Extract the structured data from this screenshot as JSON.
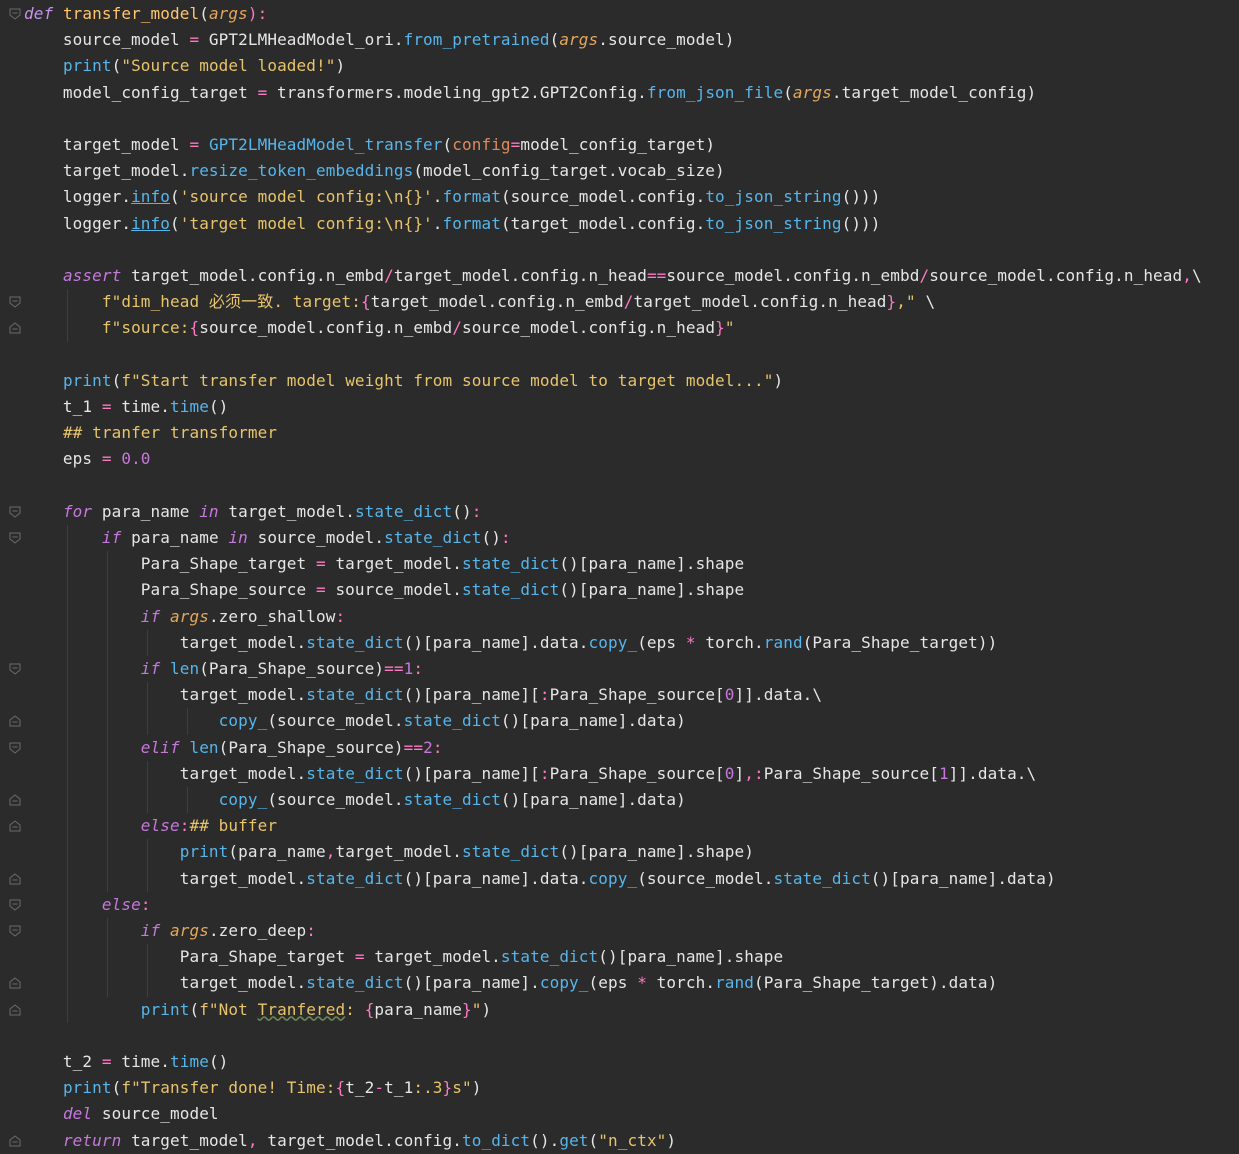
{
  "editor": {
    "language": "python",
    "theme_colors": {
      "background": "#2b2b2b",
      "keyword": "#c678dd",
      "function_name": "#ffc66d",
      "method": "#56b6ec",
      "string": "#e8c46a",
      "number": "#c678dd",
      "operator": "#ff79c6",
      "argument": "#e5a75b"
    },
    "lines": [
      [
        [
          "def",
          "def"
        ],
        [
          " ",
          "d"
        ],
        [
          "transfer_model",
          "fn"
        ],
        [
          "(",
          "p"
        ],
        [
          "args",
          "arg"
        ],
        [
          "):",
          "op"
        ]
      ],
      [
        [
          "    source_model ",
          "d"
        ],
        [
          "=",
          "op"
        ],
        [
          " GPT2LMHeadModel_ori.",
          "d"
        ],
        [
          "from_pretrained",
          "m"
        ],
        [
          "(",
          "p"
        ],
        [
          "args",
          "arg"
        ],
        [
          ".source_model)",
          "d"
        ]
      ],
      [
        [
          "    ",
          "d"
        ],
        [
          "print",
          "b"
        ],
        [
          "(",
          "p"
        ],
        [
          "\"Source model loaded!\"",
          "s"
        ],
        [
          ")",
          "p"
        ]
      ],
      [
        [
          "    model_config_target ",
          "d"
        ],
        [
          "=",
          "op"
        ],
        [
          " transformers.modeling_gpt2.GPT2Config.",
          "d"
        ],
        [
          "from_json_file",
          "m"
        ],
        [
          "(",
          "p"
        ],
        [
          "args",
          "arg"
        ],
        [
          ".target_model_config)",
          "d"
        ]
      ],
      [],
      [
        [
          "    target_model ",
          "d"
        ],
        [
          "=",
          "op"
        ],
        [
          " ",
          "d"
        ],
        [
          "GPT2LMHeadModel_transfer",
          "m"
        ],
        [
          "(",
          "p"
        ],
        [
          "config",
          "param"
        ],
        [
          "=",
          "op"
        ],
        [
          "model_config_target)",
          "d"
        ]
      ],
      [
        [
          "    target_model.",
          "d"
        ],
        [
          "resize_token_embeddings",
          "m"
        ],
        [
          "(model_config_target.vocab_size)",
          "d"
        ]
      ],
      [
        [
          "    logger.",
          "d"
        ],
        [
          "info",
          "mu"
        ],
        [
          "(",
          "p"
        ],
        [
          "'source model config:",
          "s"
        ],
        [
          "\\n",
          "s"
        ],
        [
          "{}'",
          "s"
        ],
        [
          ".",
          "p"
        ],
        [
          "format",
          "m"
        ],
        [
          "(source_model.config.",
          "d"
        ],
        [
          "to_json_string",
          "m"
        ],
        [
          "()))",
          "d"
        ]
      ],
      [
        [
          "    logger.",
          "d"
        ],
        [
          "info",
          "mu"
        ],
        [
          "(",
          "p"
        ],
        [
          "'target model config:",
          "s"
        ],
        [
          "\\n",
          "s"
        ],
        [
          "{}'",
          "s"
        ],
        [
          ".",
          "p"
        ],
        [
          "format",
          "m"
        ],
        [
          "(target_model.config.",
          "d"
        ],
        [
          "to_json_string",
          "m"
        ],
        [
          "()))",
          "d"
        ]
      ],
      [],
      [
        [
          "    ",
          "d"
        ],
        [
          "assert",
          "kw"
        ],
        [
          " target_model.config.n_embd",
          "d"
        ],
        [
          "/",
          "op"
        ],
        [
          "target_model.config.n_head",
          "d"
        ],
        [
          "==",
          "op"
        ],
        [
          "source_model.config.n_embd",
          "d"
        ],
        [
          "/",
          "op"
        ],
        [
          "source_model.config.n_head",
          "d"
        ],
        [
          ",",
          "op"
        ],
        [
          "\\",
          "d"
        ]
      ],
      [
        [
          "        ",
          "d"
        ],
        [
          "f\"dim_head 必须一致. target:",
          "s"
        ],
        [
          "{",
          "op"
        ],
        [
          "target_model.config.n_embd",
          "d"
        ],
        [
          "/",
          "op"
        ],
        [
          "target_model.config.n_head",
          "d"
        ],
        [
          "}",
          "op"
        ],
        [
          ",\"",
          "s"
        ],
        [
          " \\",
          "d"
        ]
      ],
      [
        [
          "        ",
          "d"
        ],
        [
          "f\"source:",
          "s"
        ],
        [
          "{",
          "op"
        ],
        [
          "source_model.config.n_embd",
          "d"
        ],
        [
          "/",
          "op"
        ],
        [
          "source_model.config.n_head",
          "d"
        ],
        [
          "}",
          "op"
        ],
        [
          "\"",
          "s"
        ]
      ],
      [],
      [
        [
          "    ",
          "d"
        ],
        [
          "print",
          "b"
        ],
        [
          "(",
          "p"
        ],
        [
          "f\"Start transfer model weight from source model to target model...\"",
          "s"
        ],
        [
          ")",
          "p"
        ]
      ],
      [
        [
          "    t_1 ",
          "d"
        ],
        [
          "=",
          "op"
        ],
        [
          " time.",
          "d"
        ],
        [
          "time",
          "m"
        ],
        [
          "()",
          "d"
        ]
      ],
      [
        [
          "    ",
          "d"
        ],
        [
          "## tranfer transformer",
          "s"
        ]
      ],
      [
        [
          "    eps ",
          "d"
        ],
        [
          "=",
          "op"
        ],
        [
          " ",
          "d"
        ],
        [
          "0.0",
          "n"
        ]
      ],
      [],
      [
        [
          "    ",
          "d"
        ],
        [
          "for",
          "kw"
        ],
        [
          " para_name ",
          "d"
        ],
        [
          "in",
          "kw"
        ],
        [
          " target_model.",
          "d"
        ],
        [
          "state_dict",
          "m"
        ],
        [
          "()",
          "d"
        ],
        [
          ":",
          "op"
        ]
      ],
      [
        [
          "        ",
          "d"
        ],
        [
          "if",
          "kw"
        ],
        [
          " para_name ",
          "d"
        ],
        [
          "in",
          "kw"
        ],
        [
          " source_model.",
          "d"
        ],
        [
          "state_dict",
          "m"
        ],
        [
          "()",
          "d"
        ],
        [
          ":",
          "op"
        ]
      ],
      [
        [
          "            Para_Shape_target ",
          "d"
        ],
        [
          "=",
          "op"
        ],
        [
          " target_model.",
          "d"
        ],
        [
          "state_dict",
          "m"
        ],
        [
          "()[para_name].shape",
          "d"
        ]
      ],
      [
        [
          "            Para_Shape_source ",
          "d"
        ],
        [
          "=",
          "op"
        ],
        [
          " source_model.",
          "d"
        ],
        [
          "state_dict",
          "m"
        ],
        [
          "()[para_name].shape",
          "d"
        ]
      ],
      [
        [
          "            ",
          "d"
        ],
        [
          "if",
          "kw"
        ],
        [
          " ",
          "d"
        ],
        [
          "args",
          "arg"
        ],
        [
          ".zero_shallow",
          "d"
        ],
        [
          ":",
          "op"
        ]
      ],
      [
        [
          "                target_model.",
          "d"
        ],
        [
          "state_dict",
          "m"
        ],
        [
          "()[para_name].data.",
          "d"
        ],
        [
          "copy_",
          "m"
        ],
        [
          "(eps ",
          "d"
        ],
        [
          "*",
          "op"
        ],
        [
          " torch.",
          "d"
        ],
        [
          "rand",
          "m"
        ],
        [
          "(Para_Shape_target))",
          "d"
        ]
      ],
      [
        [
          "            ",
          "d"
        ],
        [
          "if",
          "kw"
        ],
        [
          " ",
          "d"
        ],
        [
          "len",
          "b"
        ],
        [
          "(Para_Shape_source)",
          "d"
        ],
        [
          "==",
          "op"
        ],
        [
          "1",
          "n"
        ],
        [
          ":",
          "op"
        ]
      ],
      [
        [
          "                target_model.",
          "d"
        ],
        [
          "state_dict",
          "m"
        ],
        [
          "()[para_name][",
          "d"
        ],
        [
          ":",
          "op"
        ],
        [
          "Para_Shape_source[",
          "d"
        ],
        [
          "0",
          "n"
        ],
        [
          "]].data.\\",
          "d"
        ]
      ],
      [
        [
          "                    ",
          "d"
        ],
        [
          "copy_",
          "m"
        ],
        [
          "(source_model.",
          "d"
        ],
        [
          "state_dict",
          "m"
        ],
        [
          "()[para_name].data)",
          "d"
        ]
      ],
      [
        [
          "            ",
          "d"
        ],
        [
          "elif",
          "kw"
        ],
        [
          " ",
          "d"
        ],
        [
          "len",
          "b"
        ],
        [
          "(Para_Shape_source)",
          "d"
        ],
        [
          "==",
          "op"
        ],
        [
          "2",
          "n"
        ],
        [
          ":",
          "op"
        ]
      ],
      [
        [
          "                target_model.",
          "d"
        ],
        [
          "state_dict",
          "m"
        ],
        [
          "()[para_name][",
          "d"
        ],
        [
          ":",
          "op"
        ],
        [
          "Para_Shape_source[",
          "d"
        ],
        [
          "0",
          "n"
        ],
        [
          "]",
          "d"
        ],
        [
          ",",
          "op"
        ],
        [
          ":",
          "op"
        ],
        [
          "Para_Shape_source[",
          "d"
        ],
        [
          "1",
          "n"
        ],
        [
          "]].data.\\",
          "d"
        ]
      ],
      [
        [
          "                    ",
          "d"
        ],
        [
          "copy_",
          "m"
        ],
        [
          "(source_model.",
          "d"
        ],
        [
          "state_dict",
          "m"
        ],
        [
          "()[para_name].data)",
          "d"
        ]
      ],
      [
        [
          "            ",
          "d"
        ],
        [
          "else",
          "kw"
        ],
        [
          ":",
          "op"
        ],
        [
          "## buffer",
          "s"
        ]
      ],
      [
        [
          "                ",
          "d"
        ],
        [
          "print",
          "b"
        ],
        [
          "(para_name",
          "d"
        ],
        [
          ",",
          "op"
        ],
        [
          "target_model.",
          "d"
        ],
        [
          "state_dict",
          "m"
        ],
        [
          "()[para_name].shape)",
          "d"
        ]
      ],
      [
        [
          "                target_model.",
          "d"
        ],
        [
          "state_dict",
          "m"
        ],
        [
          "()[para_name].data.",
          "d"
        ],
        [
          "copy_",
          "m"
        ],
        [
          "(source_model.",
          "d"
        ],
        [
          "state_dict",
          "m"
        ],
        [
          "()[para_name].data)",
          "d"
        ]
      ],
      [
        [
          "        ",
          "d"
        ],
        [
          "else",
          "kw"
        ],
        [
          ":",
          "op"
        ]
      ],
      [
        [
          "            ",
          "d"
        ],
        [
          "if",
          "kw"
        ],
        [
          " ",
          "d"
        ],
        [
          "args",
          "arg"
        ],
        [
          ".zero_deep",
          "d"
        ],
        [
          ":",
          "op"
        ]
      ],
      [
        [
          "                Para_Shape_target ",
          "d"
        ],
        [
          "=",
          "op"
        ],
        [
          " target_model.",
          "d"
        ],
        [
          "state_dict",
          "m"
        ],
        [
          "()[para_name].shape",
          "d"
        ]
      ],
      [
        [
          "                target_model.",
          "d"
        ],
        [
          "state_dict",
          "m"
        ],
        [
          "()[para_name].",
          "d"
        ],
        [
          "copy_",
          "m"
        ],
        [
          "(eps ",
          "d"
        ],
        [
          "*",
          "op"
        ],
        [
          " torch.",
          "d"
        ],
        [
          "rand",
          "m"
        ],
        [
          "(Para_Shape_target).data)",
          "d"
        ]
      ],
      [
        [
          "            ",
          "d"
        ],
        [
          "print",
          "b"
        ],
        [
          "(",
          "p"
        ],
        [
          "f\"Not ",
          "s"
        ],
        [
          "Tranfered",
          "sw"
        ],
        [
          ": ",
          "s"
        ],
        [
          "{",
          "op"
        ],
        [
          "para_name",
          "d"
        ],
        [
          "}",
          "op"
        ],
        [
          "\"",
          "s"
        ],
        [
          ")",
          "p"
        ]
      ],
      [],
      [
        [
          "    t_2 ",
          "d"
        ],
        [
          "=",
          "op"
        ],
        [
          " time.",
          "d"
        ],
        [
          "time",
          "m"
        ],
        [
          "()",
          "d"
        ]
      ],
      [
        [
          "    ",
          "d"
        ],
        [
          "print",
          "b"
        ],
        [
          "(",
          "p"
        ],
        [
          "f\"Transfer done! Time:",
          "s"
        ],
        [
          "{",
          "op"
        ],
        [
          "t_2",
          "d"
        ],
        [
          "-",
          "op"
        ],
        [
          "t_1",
          "d"
        ],
        [
          ":.3",
          "s"
        ],
        [
          "}",
          "op"
        ],
        [
          "s\"",
          "s"
        ],
        [
          ")",
          "p"
        ]
      ],
      [
        [
          "    ",
          "d"
        ],
        [
          "del",
          "kw"
        ],
        [
          " source_model",
          "d"
        ]
      ],
      [
        [
          "    ",
          "d"
        ],
        [
          "return",
          "kw"
        ],
        [
          " target_model",
          "d"
        ],
        [
          ",",
          "op"
        ],
        [
          " target_model.config.",
          "d"
        ],
        [
          "to_dict",
          "m"
        ],
        [
          "().",
          "d"
        ],
        [
          "get",
          "m"
        ],
        [
          "(",
          "p"
        ],
        [
          "\"n_ctx\"",
          "s"
        ],
        [
          ")",
          "p"
        ]
      ]
    ]
  }
}
